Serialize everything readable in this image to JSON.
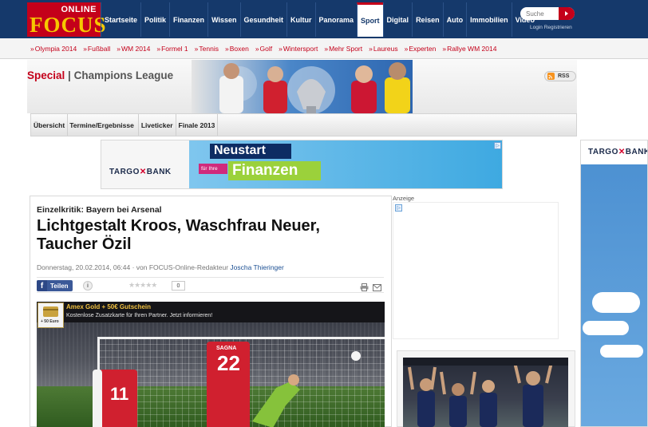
{
  "header": {
    "logo_top": "ONLINE",
    "logo_main": "FOCUS",
    "nav": [
      "Startseite",
      "Politik",
      "Finanzen",
      "Wissen",
      "Gesundheit",
      "Kultur",
      "Panorama",
      "Sport",
      "Digital",
      "Reisen",
      "Auto",
      "Immobilien",
      "Video"
    ],
    "active_nav": "Sport",
    "search_placeholder": "Suche",
    "login": "Login Registrieren"
  },
  "subnav": [
    "Olympia 2014",
    "Fußball",
    "WM 2014",
    "Formel 1",
    "Tennis",
    "Boxen",
    "Golf",
    "Wintersport",
    "Mehr Sport",
    "Laureus",
    "Experten",
    "Rallye WM 2014"
  ],
  "special": {
    "label": "Special",
    "title": "Champions League",
    "rss": "RSS"
  },
  "tabs": [
    "Übersicht",
    "Termine/Ergebnisse",
    "Liveticker",
    "Finale 2013"
  ],
  "ad_top": {
    "brand": "TARGO",
    "brand_x": "✕",
    "brand_bank": "BANK",
    "headline1": "Neustart",
    "tag": "für Ihre",
    "headline2": "Finanzen"
  },
  "ad_right": {
    "brand": "TARGO",
    "brand_x": "✕",
    "brand_bank": "BANK"
  },
  "article": {
    "kicker": "Einzelkritik: Bayern bei Arsenal",
    "headline": "Lichtgestalt Kroos, Waschfrau Neuer, Taucher Özil",
    "date": "Donnerstag, 20.02.2014, 06:44",
    "byline_prefix": "· von FOCUS-Online-Redakteur",
    "author": "Joscha Thieringer",
    "share_label": "Teilen",
    "rating_stars": "★★★★★",
    "rating_count": "0",
    "photo_ad_title": "Amex Gold + 50€ Gutschein",
    "photo_ad_desc": "Kostenlose Zusatzkarte für Ihren Partner. Jetzt informieren!",
    "photo_ad_thumb": "+ 50 Euro",
    "player_numbers": [
      "11",
      "22"
    ],
    "player_name": "SAGNA"
  },
  "sidebar": {
    "anzeige": "Anzeige"
  },
  "colors": {
    "nav_blue": "#15396b",
    "focus_red": "#c4001a",
    "focus_yellow": "#f6c800",
    "arsenal_red": "#d0202f",
    "targo_blue": "#0d2c63"
  }
}
